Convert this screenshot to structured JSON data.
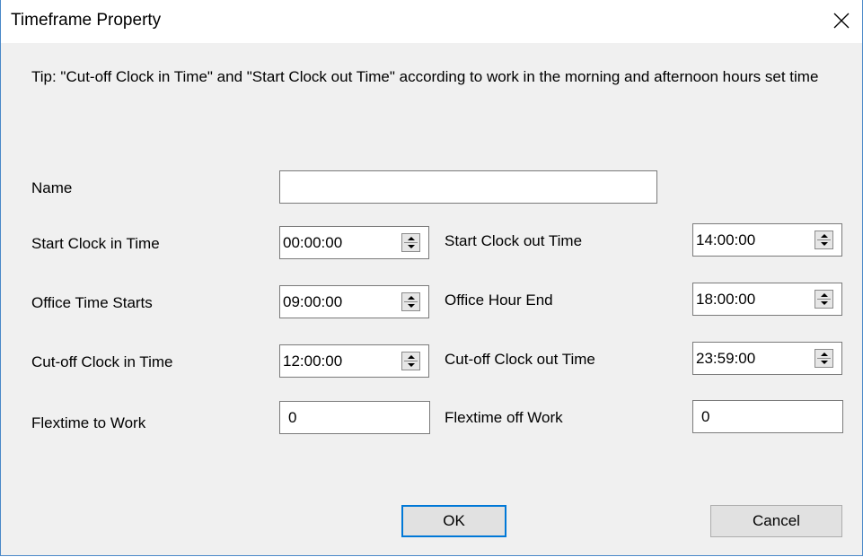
{
  "window": {
    "title": "Timeframe Property",
    "tip": "Tip: \"Cut-off Clock in Time\" and \"Start Clock out Time\" according to work in the morning and afternoon hours set time"
  },
  "fields": {
    "name": {
      "label": "Name",
      "value": ""
    },
    "start_clock_in": {
      "label": "Start Clock in Time",
      "value": "00:00:00"
    },
    "office_time_starts": {
      "label": "Office Time Starts",
      "value": "09:00:00"
    },
    "cutoff_clock_in": {
      "label": "Cut-off Clock in Time",
      "value": "12:00:00"
    },
    "flextime_to_work": {
      "label": "Flextime to Work",
      "value": "0"
    },
    "start_clock_out": {
      "label": "Start Clock out Time",
      "value": "14:00:00"
    },
    "office_hour_end": {
      "label": "Office Hour End",
      "value": "18:00:00"
    },
    "cutoff_clock_out": {
      "label": "Cut-off Clock out Time",
      "value": "23:59:00"
    },
    "flextime_off_work": {
      "label": "Flextime off Work",
      "value": "0"
    }
  },
  "buttons": {
    "ok": "OK",
    "cancel": "Cancel"
  },
  "icons": {
    "close": "close-icon",
    "spinner": "spin-updown-icon"
  },
  "colors": {
    "window_border": "#4a88c8",
    "default_button_border": "#0078d7",
    "dialog_background": "#f0f0f0"
  }
}
